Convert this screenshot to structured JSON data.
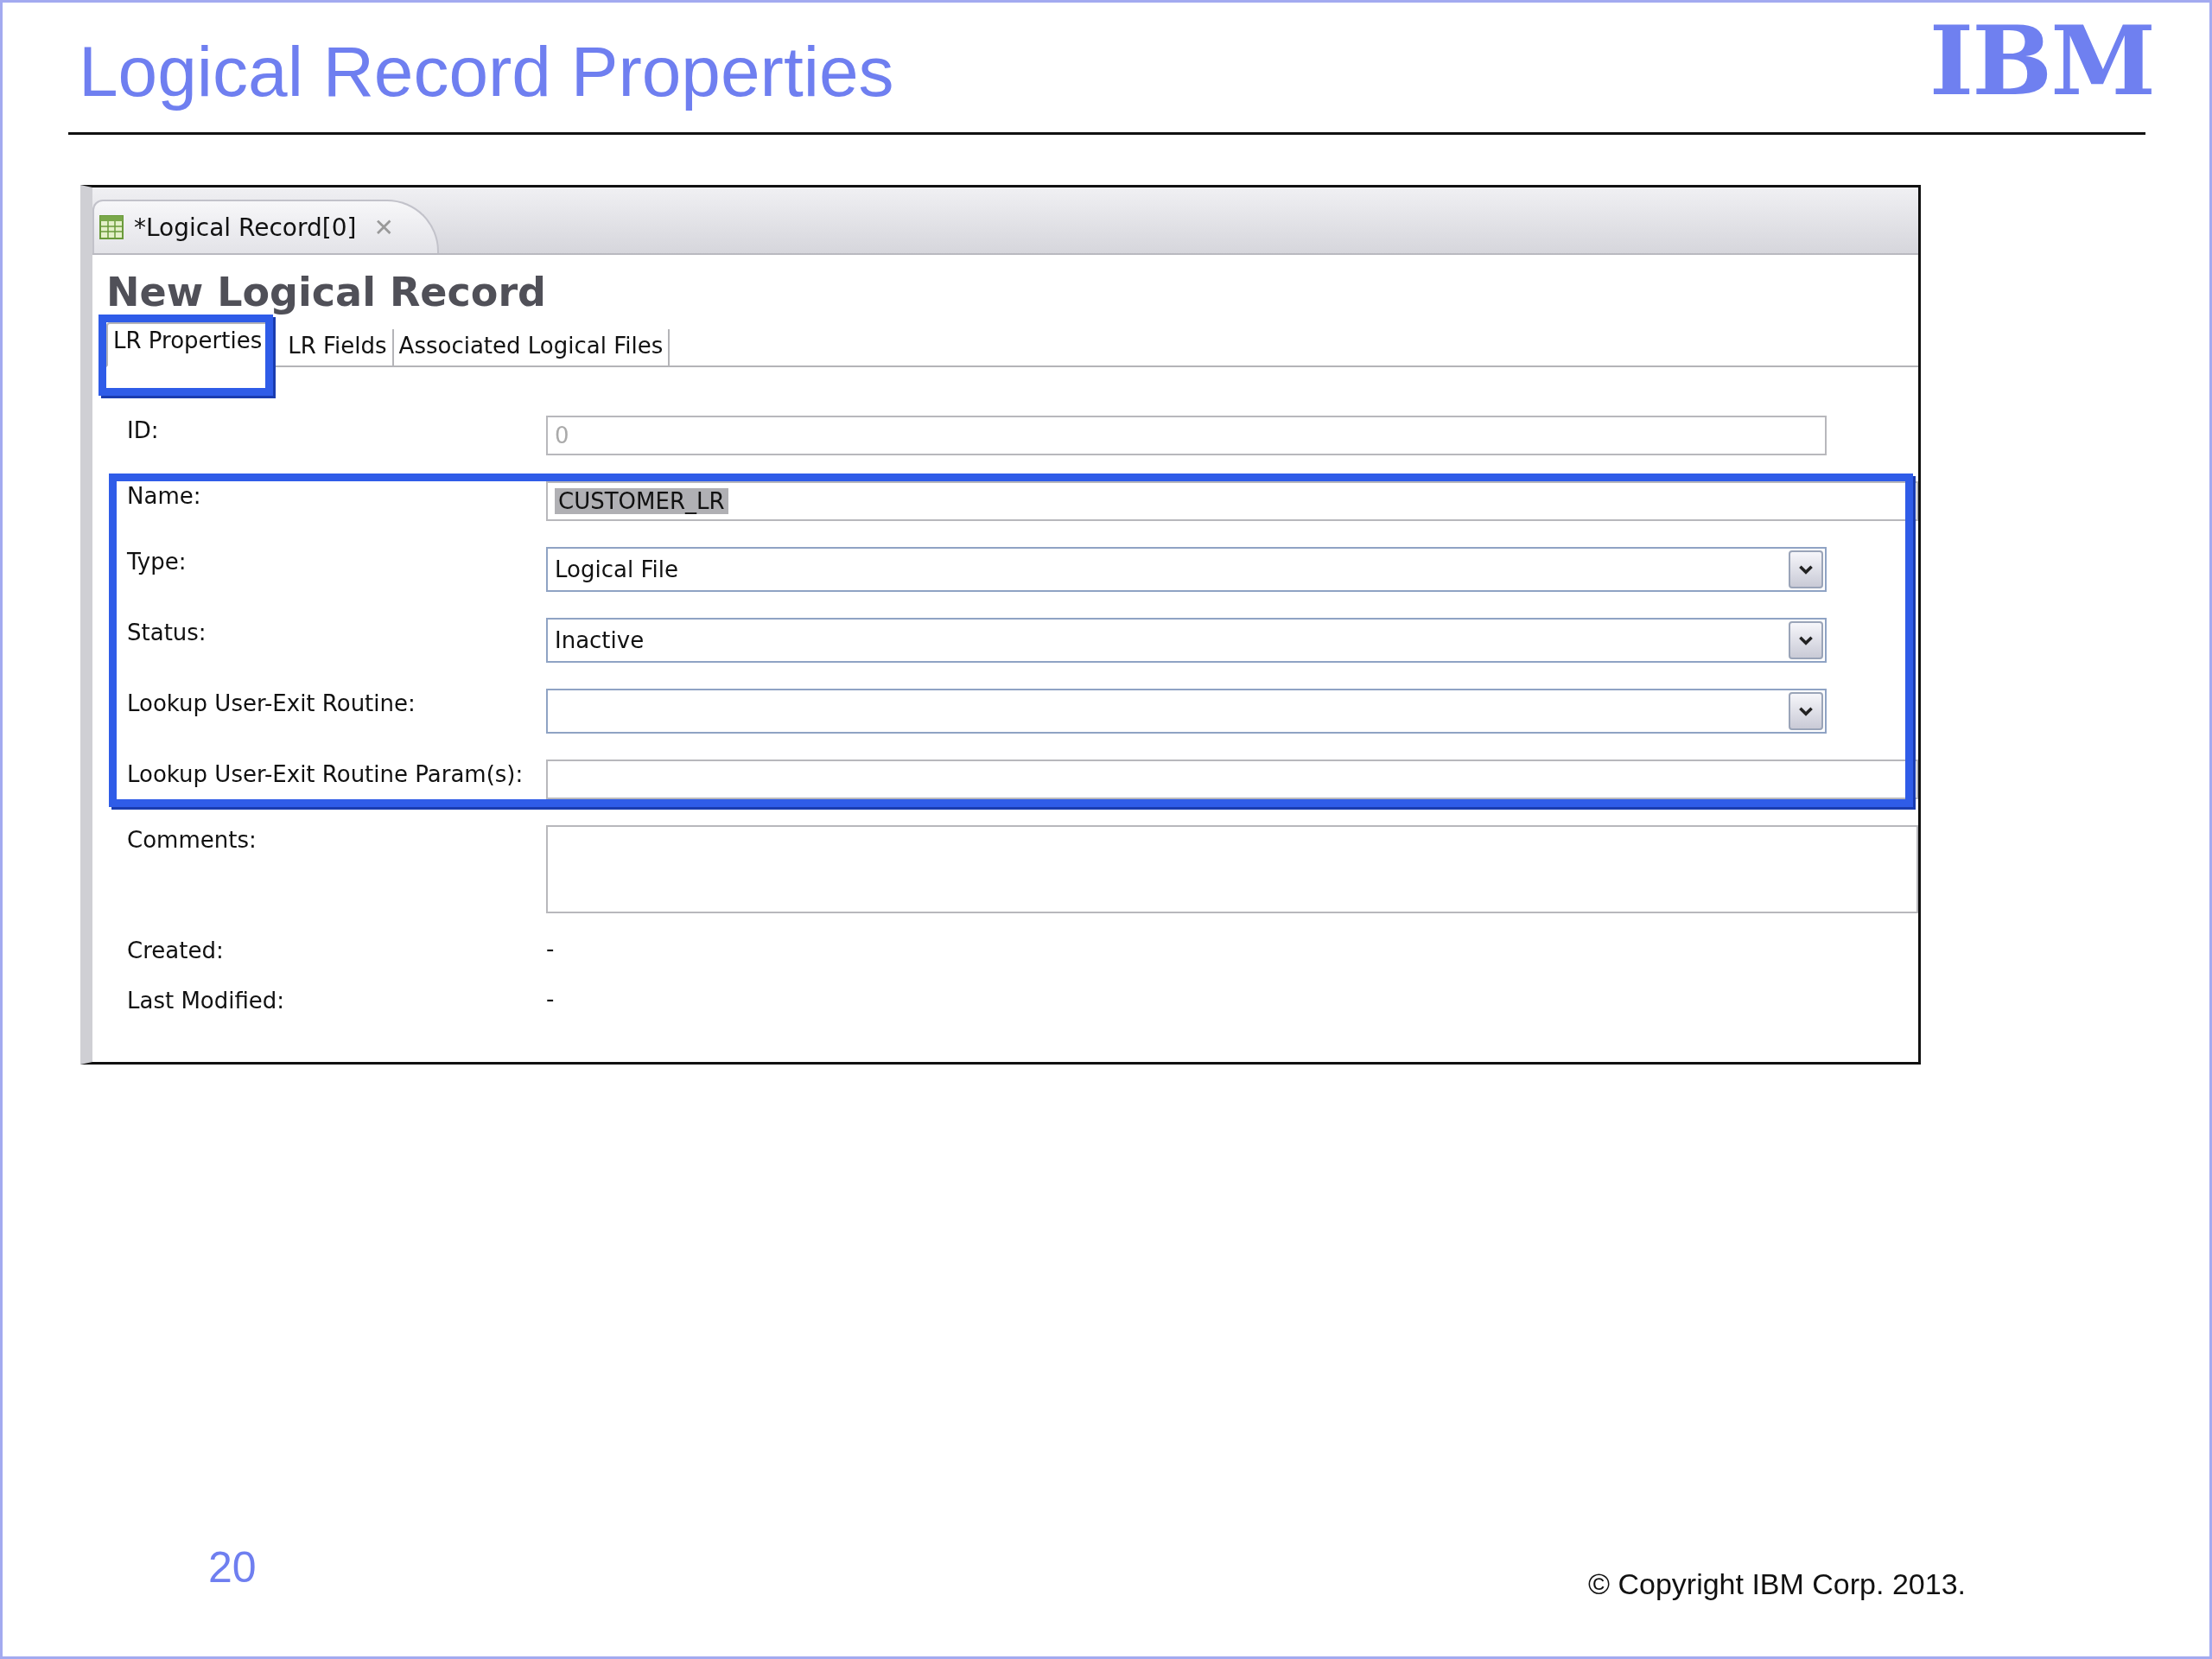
{
  "slide": {
    "title": "Logical Record Properties",
    "logo": "IBM",
    "page_number": "20",
    "copyright": "© Copyright IBM Corp. 2013."
  },
  "editor": {
    "tab": {
      "label": "*Logical Record[0]",
      "close": "✕"
    },
    "heading": "New Logical Record",
    "tabs": [
      {
        "label": "LR Properties",
        "selected": true,
        "callout": true
      },
      {
        "label": "LR Fields",
        "selected": false,
        "callout": false
      },
      {
        "label": "Associated Logical Files",
        "selected": false,
        "callout": false
      }
    ],
    "fields": [
      {
        "kind": "text",
        "label": "ID:",
        "value": "0",
        "disabled": true,
        "callout": false
      },
      {
        "kind": "text",
        "label": "Name:",
        "value": "CUSTOMER_LR",
        "highlighted": true,
        "callout": true
      },
      {
        "kind": "combo",
        "label": "Type:",
        "value": "Logical File",
        "callout": true
      },
      {
        "kind": "combo",
        "label": "Status:",
        "value": "Inactive",
        "callout": true
      },
      {
        "kind": "combo",
        "label": "Lookup User-Exit Routine:",
        "callout": true
      },
      {
        "kind": "text",
        "label": "Lookup User-Exit Routine Param(s):",
        "callout": true
      },
      {
        "kind": "textarea",
        "label": "Comments:",
        "callout": false
      },
      {
        "kind": "value",
        "label": "Created:",
        "value": "-",
        "callout": false
      },
      {
        "kind": "value",
        "label": "Last Modified:",
        "value": "-",
        "callout": false
      }
    ]
  }
}
